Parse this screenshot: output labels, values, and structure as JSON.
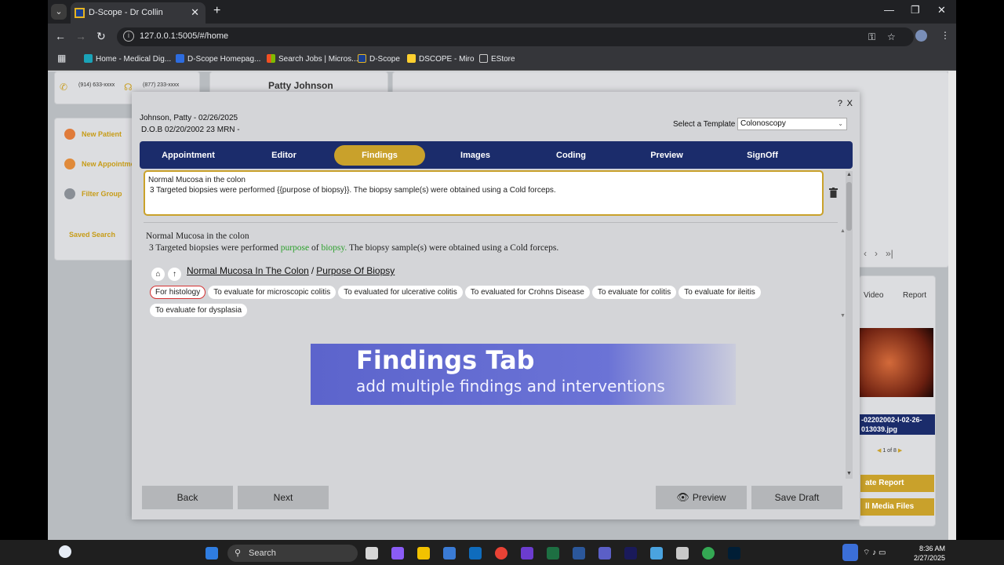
{
  "browser": {
    "tab_title": "D-Scope - Dr Collin",
    "url": "127.0.0.1:5005/#/home",
    "bookmarks": [
      "Home - Medical Dig...",
      "D-Scope Homepag...",
      "Search Jobs | Micros...",
      "D-Scope",
      "DSCOPE - Miro",
      "EStore"
    ]
  },
  "background_app": {
    "phone_1": "(914) 633-xxxx",
    "phone_2": "(877) 233-xxxx",
    "patient_name": "Patty Johnson",
    "sidebar": [
      "New Patient",
      "New Appointment",
      "Filter Group",
      "Saved Search"
    ],
    "media_tabs": [
      "Video",
      "Report"
    ],
    "image_filename_1": "-02202002-I-02-26-",
    "image_filename_2": "013039.jpg",
    "pager": "1 of 8",
    "buttons": [
      "ate Report",
      "ll Media Files"
    ]
  },
  "modal": {
    "patient_line": "Johnson, Patty - 02/26/2025",
    "dob_line": "D.O.B 02/20/2002 23 MRN -",
    "help": "?",
    "close": "X",
    "template_label": "Select a Template",
    "template_value": "Colonoscopy",
    "tabs": [
      "Appointment",
      "Editor",
      "Findings",
      "Images",
      "Coding",
      "Preview",
      "SignOff"
    ],
    "active_tab": "Findings",
    "editor_line_1": "Normal Mucosa in the colon",
    "editor_line_2": "3 Targeted biopsies were performed {{purpose of biopsy}}. The biopsy sample(s) were obtained using a Cold forceps.",
    "preview": {
      "line_1": "Normal Mucosa in the colon",
      "line_2_a": "3 Targeted biopsies were performed ",
      "line_2_b": "purpose",
      "line_2_c": " of ",
      "line_2_d": "biopsy.",
      "line_2_e": " The biopsy sample(s) were obtained using a Cold forceps."
    },
    "breadcrumb": [
      "Normal Mucosa In The Colon",
      "/",
      "Purpose Of Biopsy"
    ],
    "options": [
      "For histology",
      "To evaluate for microscopic colitis",
      "To evaluated for ulcerative colitis",
      "To evaluated for Crohns Disease",
      "To evaluate for colitis",
      "To evaluate for ileitis",
      "To evaluate for dysplasia"
    ],
    "selected_option": "For histology",
    "banner_title": "Findings Tab",
    "banner_subtitle": "add multiple findings and interventions",
    "buttons": {
      "back": "Back",
      "next": "Next",
      "preview": "Preview",
      "save": "Save Draft"
    }
  },
  "taskbar": {
    "search": "Search",
    "time": "8:36 AM",
    "date": "2/27/2025"
  },
  "colors": {
    "navy": "#1b2c6b",
    "gold": "#c9a12b",
    "green_text": "#2ca02c",
    "selected_border": "#d43030"
  }
}
